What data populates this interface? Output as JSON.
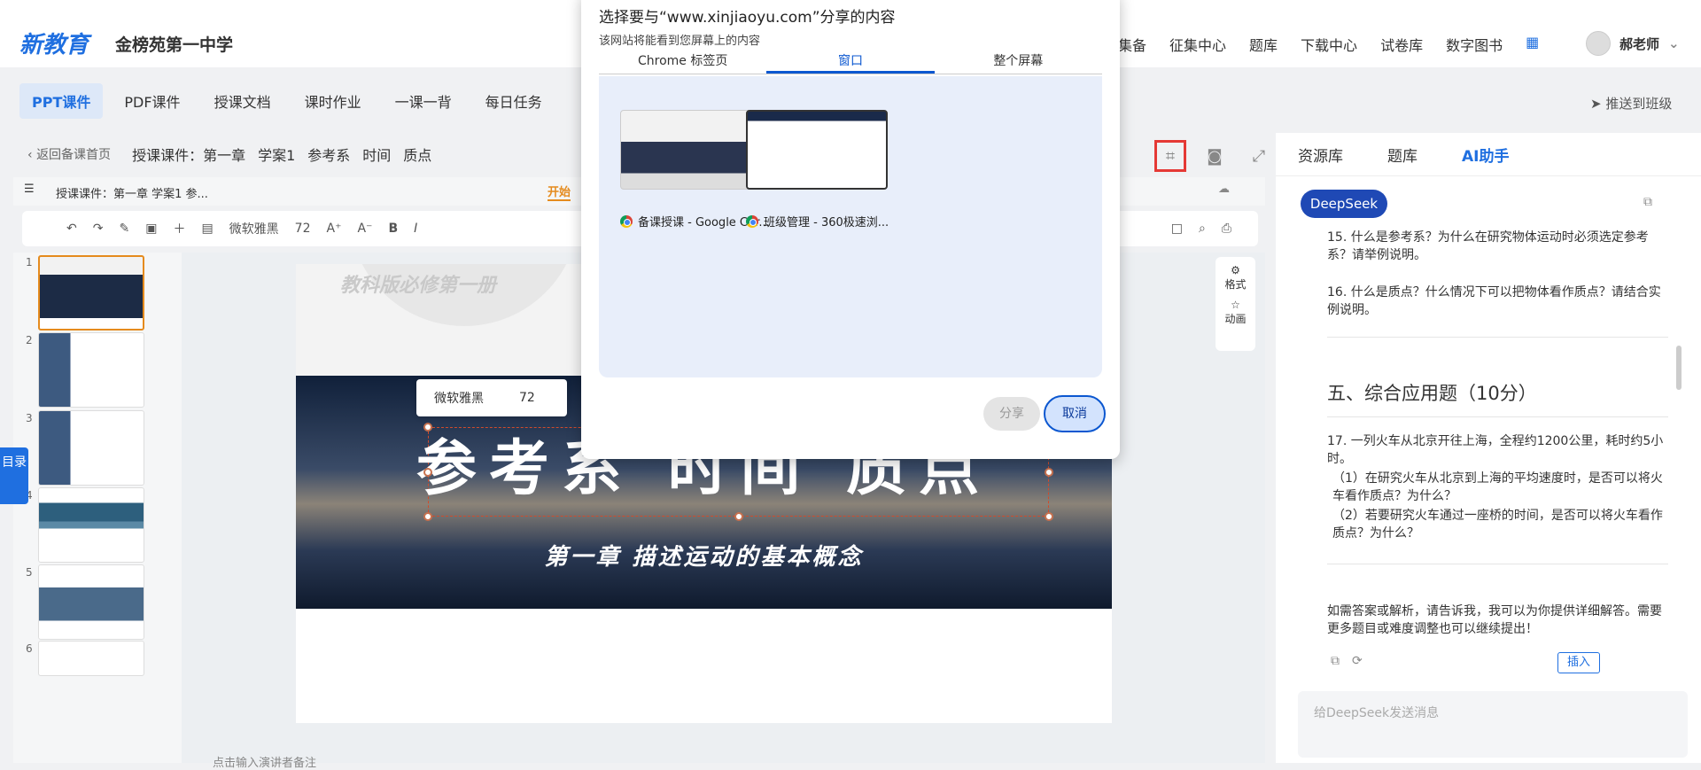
{
  "header": {
    "logo": "新教育",
    "school": "金榜苑第一中学",
    "nav": [
      "集备",
      "征集中心",
      "题库",
      "下载中心",
      "试卷库",
      "数字图书"
    ],
    "user": "郝老师"
  },
  "subnav": {
    "tabs": [
      "PPT课件",
      "PDF课件",
      "授课文档",
      "课时作业",
      "一课一背",
      "每日任务"
    ],
    "push": "推送到班级"
  },
  "editor": {
    "back": "返回备课首页",
    "breadcrumb": [
      "授课课件：第一章",
      "学案1",
      "参考系",
      "时间",
      "质点"
    ],
    "doc_title": "授课课件：第一章    学案1    参...",
    "start_tab": "开始",
    "font_name": "微软雅黑",
    "font_size": "72",
    "side_format": "格式",
    "side_anim": "动画",
    "toc": "目录"
  },
  "slide": {
    "top_text": "教科版必修第一册",
    "title": "参考系  时间  质点",
    "subtitle": "第一章   描述运动的基本概念",
    "float_font": "微软雅黑",
    "float_size": "72",
    "note": "点击输入演讲者备注"
  },
  "thumbs": [
    "1",
    "2",
    "3",
    "4",
    "5",
    "6"
  ],
  "right": {
    "tabs": [
      "资源库",
      "题库",
      "AI助手"
    ],
    "deepseek": "DeepSeek",
    "q15": "15. 什么是参考系？为什么在研究物体运动时必须选定参考系？请举例说明。",
    "q16": "16. 什么是质点？什么情况下可以把物体看作质点？请结合实例说明。",
    "section": "五、综合应用题（10分）",
    "q17a": "17. 一列火车从北京开往上海，全程约1200公里，耗时约5小时。",
    "q17b": "（1）在研究火车从北京到上海的平均速度时，是否可以将火车看作质点？为什么？",
    "q17c": "（2）若要研究火车通过一座桥的时间，是否可以将火车看作质点？为什么？",
    "followup": "如需答案或解析，请告诉我，我可以为你提供详细解答。需要更多题目或难度调整也可以继续提出！",
    "insert": "插入",
    "input_placeholder": "给DeepSeek发送消息"
  },
  "dialog": {
    "title": "选择要与“www.xinjiaoyu.com”分享的内容",
    "subtitle": "该网站将能看到您屏幕上的内容",
    "tabs": [
      "Chrome 标签页",
      "窗口",
      "整个屏幕"
    ],
    "windows": [
      "备课授课 - Google Chr...",
      "班级管理 - 360极速浏..."
    ],
    "share": "分享",
    "cancel": "取消"
  }
}
